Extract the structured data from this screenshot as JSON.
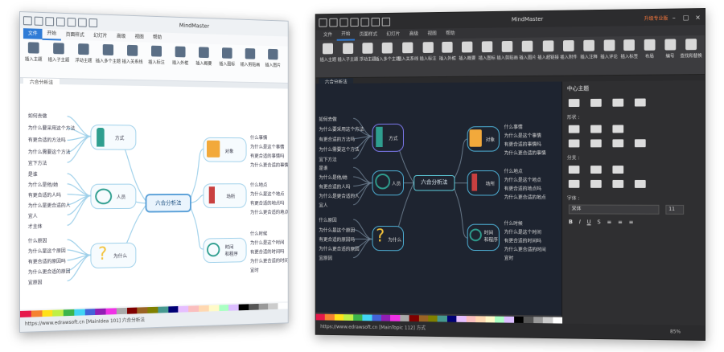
{
  "light": {
    "title": "MindMaster",
    "menu": [
      "文件",
      "开始",
      "页面样式",
      "幻灯片",
      "高级",
      "视图",
      "帮助"
    ],
    "ribbon": [
      "插入主题",
      "插入子主题",
      "浮动主题",
      "插入多个主题",
      "插入关系线",
      "插入标注",
      "插入外框",
      "插入概要",
      "插入图标",
      "插入剪贴画",
      "插入图片"
    ],
    "doc_tab": "六合分析法",
    "center": "六合分析法",
    "topics": {
      "way": "方式",
      "people": "人员",
      "why": "为什么",
      "object": "对象",
      "place": "场所",
      "time": "时间\n和程序"
    },
    "way_items": [
      "如何去做",
      "为什么要采用这个方法",
      "有更合适的方法吗",
      "为什么需要这个方法",
      "宜下方法"
    ],
    "people_items": [
      "是谁",
      "为什么是他/她",
      "有更合适的人吗",
      "为什么是更合适的人",
      "宜人",
      "才主体"
    ],
    "why_items": [
      "什么原因",
      "为什么是这个原因",
      "有更合适的原因吗",
      "为什么更合适的原因",
      "宜原因"
    ],
    "object_items": [
      "什么事情",
      "为什么是这个事情",
      "有更合适的事情吗",
      "为什么更合适的事情"
    ],
    "place_items": [
      "什么地点",
      "为什么是这个地点",
      "有更合适的地点吗",
      "为什么更合适的地点"
    ],
    "time_items": [
      "什么时候",
      "为什么是这个时间",
      "有更合适的时间吗",
      "为什么更合适的时间",
      "宜时"
    ],
    "status": "https://www.edrawsoft.cn  [MainIdea 101]  六合分析法",
    "colors": {
      "accent": "#2f7bd6",
      "topic_border": "#9ed0ea"
    }
  },
  "dark": {
    "title": "MindMaster",
    "login": "升级专业版",
    "menu": [
      "文件",
      "开始",
      "页面样式",
      "幻灯片",
      "高级",
      "视图",
      "帮助"
    ],
    "ribbon": [
      "插入主题",
      "插入子主题",
      "浮动主题",
      "插入多个主题",
      "插入关系线",
      "插入标注",
      "插入外框",
      "插入概要",
      "插入图标",
      "插入剪贴画",
      "插入图片",
      "插入超链接",
      "插入附件",
      "插入注释",
      "插入评论",
      "插入标签",
      "布局",
      "编号",
      "查找和替换"
    ],
    "doc_tab": "六合分析法",
    "center": "六合分析法",
    "topics": {
      "way": "方式",
      "people": "人员",
      "why": "为什么",
      "object": "对象",
      "place": "场所",
      "time": "时间\n和程序"
    },
    "way_items": [
      "如何去做",
      "为什么要采用这个方法",
      "有更合适的方法吗",
      "为什么需要这个方法",
      "宜下方法"
    ],
    "people_items": [
      "是谁",
      "为什么是他/她",
      "有更合适的人吗",
      "为什么是更合适的人",
      "宜人"
    ],
    "why_items": [
      "什么原因",
      "为什么是这个原因",
      "有更合适的原因吗",
      "为什么更合适的原因",
      "宜原因"
    ],
    "object_items": [
      "什么事情",
      "为什么是这个事情",
      "有更合适的事情吗",
      "为什么更合适的事情"
    ],
    "place_items": [
      "什么地点",
      "为什么是这个地点",
      "有更合适的地点吗",
      "为什么更合适的地点"
    ],
    "time_items": [
      "什么时候",
      "为什么是这个时间",
      "有更合适的时间吗",
      "为什么更合适的时间",
      "宜时"
    ],
    "panel": {
      "title": "中心主题",
      "shape_label": "形状 :",
      "branch_label": "分支 :",
      "font_label": "字体 :",
      "font_value": "宋体",
      "font_size": "11"
    },
    "status": "https://www.edrawsoft.cn  [MainTopic 112]  方式",
    "zoom": "85%",
    "colors": {
      "accent": "#5fd1e0",
      "bg": "#1e2430"
    }
  },
  "palette": [
    "#e6194b",
    "#f58231",
    "#ffe119",
    "#bfef45",
    "#3cb44b",
    "#42d4f4",
    "#4363d8",
    "#911eb4",
    "#f032e6",
    "#a9a9a9",
    "#800000",
    "#9a6324",
    "#808000",
    "#469990",
    "#000075",
    "#e6beff",
    "#fabebe",
    "#ffd8b1",
    "#fffac8",
    "#aaffc3",
    "#dcbeff",
    "#000000",
    "#555555",
    "#999999",
    "#cccccc",
    "#ffffff"
  ]
}
